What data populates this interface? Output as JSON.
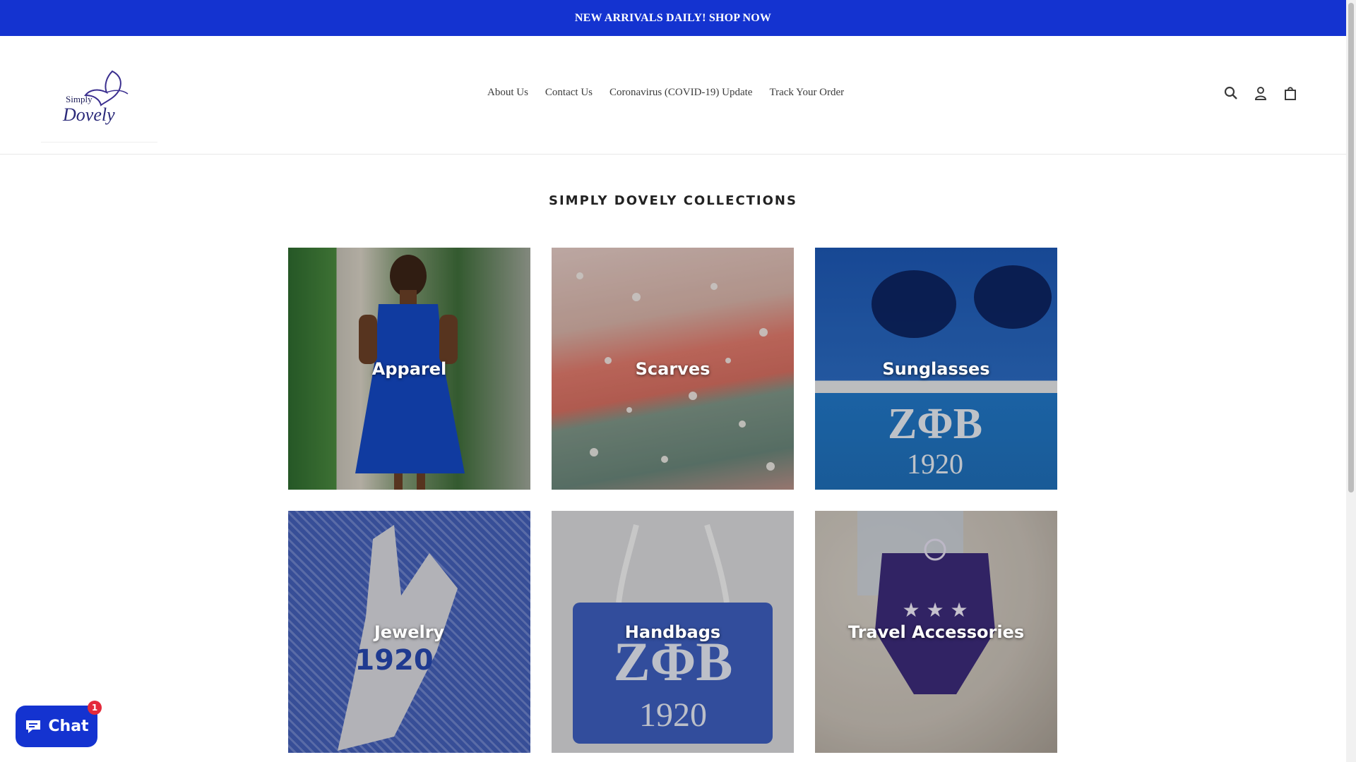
{
  "announcement": {
    "text": "NEW ARRIVALS DAILY! SHOP NOW"
  },
  "header": {
    "logo_text": "Simply Dovely",
    "nav": [
      {
        "label": "About Us"
      },
      {
        "label": "Contact Us"
      },
      {
        "label": "Coronavirus (COVID-19) Update"
      },
      {
        "label": "Track Your Order"
      }
    ],
    "icons": [
      "search-icon",
      "account-icon",
      "cart-icon"
    ]
  },
  "collections": {
    "title": "SIMPLY DOVELY COLLECTIONS",
    "items": [
      {
        "label": "Apparel"
      },
      {
        "label": "Scarves"
      },
      {
        "label": "Sunglasses"
      },
      {
        "label": "Jewelry"
      },
      {
        "label": "Handbags"
      },
      {
        "label": "Travel Accessories"
      }
    ],
    "tile_print": {
      "letters": "ZΦB",
      "year": "1920"
    }
  },
  "chat": {
    "label": "Chat",
    "badge": "1"
  },
  "colors": {
    "brand": "#1433d0",
    "badge": "#e42a3b"
  }
}
